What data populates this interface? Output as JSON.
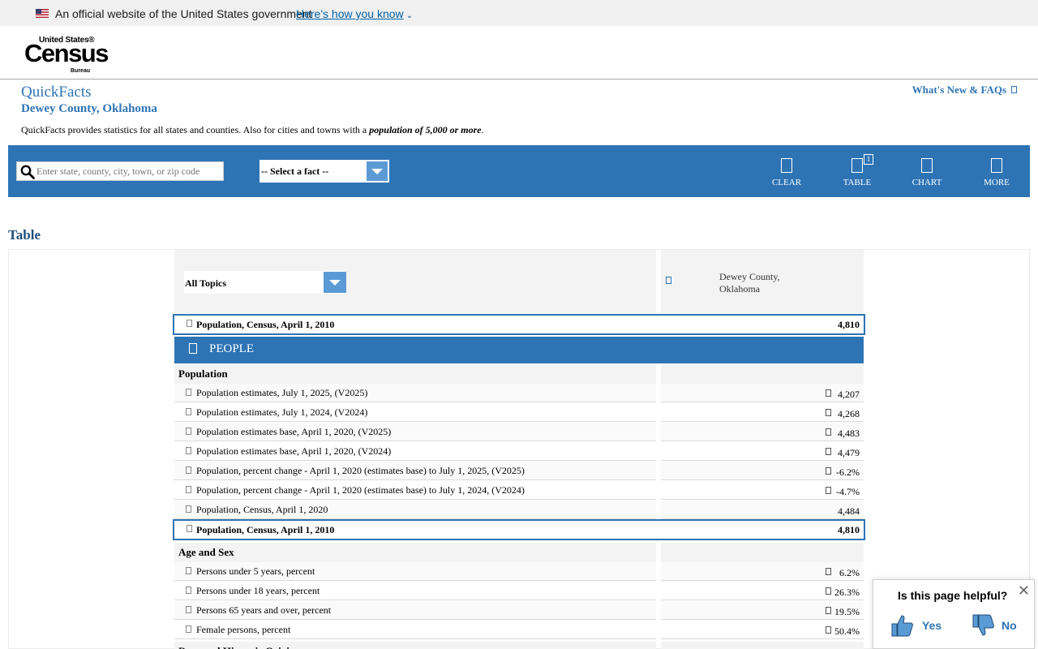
{
  "gov_banner": {
    "text": "An official website of the United States government",
    "link": "Here's how you know"
  },
  "logo": {
    "top": "United States®",
    "main": "Census",
    "bottom": "Bureau"
  },
  "page": {
    "title": "QuickFacts",
    "subtitle": "Dewey County, Oklahoma",
    "description_prefix": "QuickFacts provides statistics for all states and counties. Also for cities and towns with a ",
    "description_emphasis": "population of 5,000 or more",
    "description_suffix": ".",
    "whats_new": "What's New & FAQs"
  },
  "toolbar": {
    "search_placeholder": "Enter state, county, city, town, or zip code",
    "fact_select": "-- Select a fact --",
    "clear": "CLEAR",
    "table": "TABLE",
    "table_badge": "1",
    "chart": "CHART",
    "more": "MORE"
  },
  "table": {
    "heading": "Table",
    "topic_select": "All Topics",
    "location": "Dewey County, Oklahoma",
    "pinned_row": {
      "label": "Population, Census, April 1, 2010",
      "value": "4,810"
    },
    "section": "PEOPLE",
    "groups": [
      {
        "name": "Population",
        "rows": [
          {
            "label": "Population estimates, July 1, 2025, (V2025)",
            "value": "4,207",
            "icon": true
          },
          {
            "label": "Population estimates, July 1, 2024, (V2024)",
            "value": "4,268",
            "icon": true
          },
          {
            "label": "Population estimates base, April 1, 2020, (V2025)",
            "value": "4,483",
            "icon": true
          },
          {
            "label": "Population estimates base, April 1, 2020, (V2024)",
            "value": "4,479",
            "icon": true
          },
          {
            "label": "Population, percent change - April 1, 2020 (estimates base) to July 1, 2025, (V2025)",
            "value": "-6.2%",
            "icon": true
          },
          {
            "label": "Population, percent change - April 1, 2020 (estimates base) to July 1, 2024, (V2024)",
            "value": "-4.7%",
            "icon": true
          },
          {
            "label": "Population, Census, April 1, 2020",
            "value": "4,484",
            "icon": false
          },
          {
            "label": "Population, Census, April 1, 2010",
            "value": "4,810",
            "icon": false,
            "highlight": true
          }
        ]
      },
      {
        "name": "Age and Sex",
        "rows": [
          {
            "label": "Persons under 5 years, percent",
            "value": "6.2%",
            "icon": true
          },
          {
            "label": "Persons under 18 years, percent",
            "value": "26.3%",
            "icon": true
          },
          {
            "label": "Persons 65 years and over, percent",
            "value": "19.5%",
            "icon": true
          },
          {
            "label": "Female persons, percent",
            "value": "50.4%",
            "icon": true
          }
        ]
      },
      {
        "name": "Race and Hispanic Origin",
        "rows": []
      }
    ]
  },
  "helpful": {
    "question": "Is this page helpful?",
    "yes": "Yes",
    "no": "No"
  }
}
